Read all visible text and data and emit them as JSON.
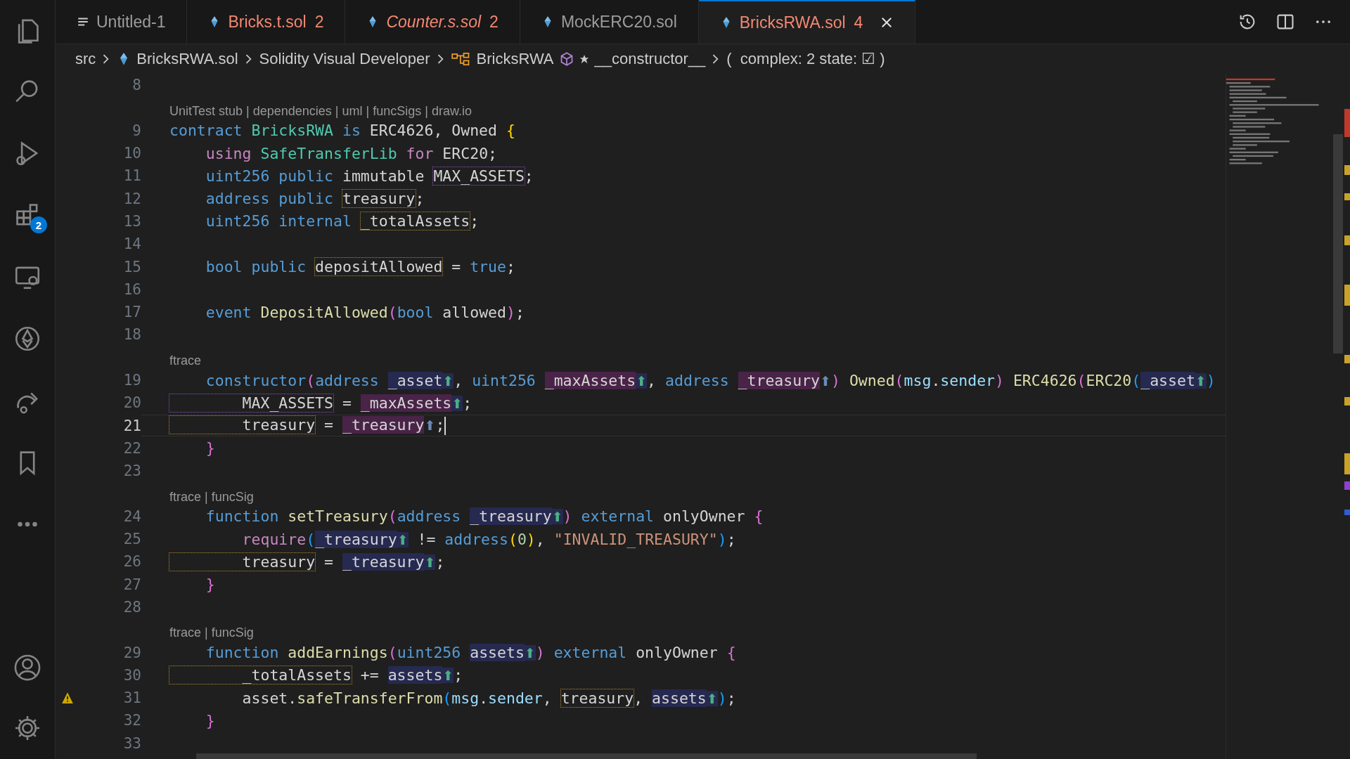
{
  "activity_bar": {
    "items": [
      {
        "kind": "files"
      },
      {
        "kind": "search"
      },
      {
        "kind": "debug"
      },
      {
        "kind": "extensions",
        "badge": "2"
      },
      {
        "kind": "remote"
      },
      {
        "kind": "ethereum"
      },
      {
        "kind": "share"
      },
      {
        "kind": "bookmark"
      },
      {
        "kind": "more"
      }
    ],
    "bottom": [
      {
        "kind": "account"
      },
      {
        "kind": "settings"
      }
    ]
  },
  "tabs": [
    {
      "label": "Untitled-1",
      "kind": "text",
      "error": false,
      "italic": false,
      "selected": false
    },
    {
      "label": "Bricks.t.sol",
      "kind": "solidity",
      "badge": "2",
      "error": true,
      "italic": false,
      "selected": false
    },
    {
      "label": "Counter.s.sol",
      "kind": "solidity",
      "badge": "2",
      "error": true,
      "italic": true,
      "selected": false
    },
    {
      "label": "MockERC20.sol",
      "kind": "solidity",
      "error": false,
      "italic": false,
      "selected": false
    },
    {
      "label": "BricksRWA.sol",
      "kind": "solidity",
      "badge": "4",
      "error": true,
      "italic": false,
      "selected": true
    }
  ],
  "breadcrumbs": [
    {
      "text": "src",
      "kind": "folder"
    },
    {
      "text": "BricksRWA.sol",
      "kind": "solidity"
    },
    {
      "text": "Solidity Visual Developer",
      "kind": "folder"
    },
    {
      "text": "BricksRWA",
      "kind": "class"
    },
    {
      "text": "__constructor__",
      "kind": "method"
    },
    {
      "text": "(  complex: 2 state: ☑ )",
      "kind": "folder"
    }
  ],
  "lines": [
    {
      "kind": "code",
      "number": "8",
      "current": false,
      "warning": false
    },
    {
      "kind": "lens",
      "text": "UnitTest stub | dependencies | uml | funcSigs | draw.io"
    },
    {
      "kind": "code",
      "number": "9",
      "current": false,
      "warning": false,
      "tokens": [
        {
          "text": "contract ",
          "kind": "kw"
        },
        {
          "text": "BricksRWA",
          "kind": "type"
        },
        {
          "text": " is ",
          "kind": "kw"
        },
        {
          "text": "ERC4626, Owned ",
          "kind": "plain"
        },
        {
          "text": "{",
          "kind": "b1"
        }
      ]
    },
    {
      "kind": "code",
      "number": "10",
      "current": false,
      "warning": false,
      "tokens": [
        {
          "text": "    using ",
          "kind": "ctrl"
        },
        {
          "text": "SafeTransferLib",
          "kind": "type"
        },
        {
          "text": " for ",
          "kind": "ctrl"
        },
        {
          "text": "ERC20;",
          "kind": "plain"
        }
      ]
    },
    {
      "kind": "code",
      "number": "11",
      "current": false,
      "warning": false,
      "tokens": [
        {
          "text": "    uint256 public",
          "kind": "kw"
        },
        {
          "text": " immutable ",
          "kind": "plain"
        },
        {
          "text": "MAX_ASSETS",
          "kind": "boxed2"
        },
        {
          "text": ";",
          "kind": "plain"
        }
      ]
    },
    {
      "kind": "code",
      "number": "12",
      "current": false,
      "warning": false,
      "tokens": [
        {
          "text": "    address public ",
          "kind": "kw"
        },
        {
          "text": "treasury",
          "kind": "boxed"
        },
        {
          "text": ";",
          "kind": "plain"
        }
      ]
    },
    {
      "kind": "code",
      "number": "13",
      "current": false,
      "warning": false,
      "tokens": [
        {
          "text": "    uint256 internal ",
          "kind": "kw"
        },
        {
          "text": "_totalAssets",
          "kind": "boxed"
        },
        {
          "text": ";",
          "kind": "plain"
        }
      ]
    },
    {
      "kind": "code",
      "number": "14",
      "current": false,
      "warning": false
    },
    {
      "kind": "code",
      "number": "15",
      "current": false,
      "warning": false,
      "tokens": [
        {
          "text": "    bool public ",
          "kind": "kw"
        },
        {
          "text": "depositAllowed",
          "kind": "boxed"
        },
        {
          "text": " = ",
          "kind": "plain"
        },
        {
          "text": "true",
          "kind": "kw"
        },
        {
          "text": ";",
          "kind": "plain"
        }
      ]
    },
    {
      "kind": "code",
      "number": "16",
      "current": false,
      "warning": false
    },
    {
      "kind": "code",
      "number": "17",
      "current": false,
      "warning": false,
      "tokens": [
        {
          "text": "    event ",
          "kind": "kw"
        },
        {
          "text": "DepositAllowed",
          "kind": "fn"
        },
        {
          "text": "(",
          "kind": "b2"
        },
        {
          "text": "bool",
          "kind": "kw"
        },
        {
          "text": " allowed",
          "kind": "plain"
        },
        {
          "text": ")",
          "kind": "b2"
        },
        {
          "text": ";",
          "kind": "plain"
        }
      ]
    },
    {
      "kind": "code",
      "number": "18",
      "current": false,
      "warning": false
    },
    {
      "kind": "lens",
      "text": "ftrace"
    },
    {
      "kind": "code",
      "number": "19",
      "current": false,
      "warning": false,
      "tokens": [
        {
          "text": "    constructor",
          "kind": "kw"
        },
        {
          "text": "(",
          "kind": "b2"
        },
        {
          "text": "address ",
          "kind": "kw"
        },
        {
          "text": "_asset",
          "kind": "param"
        },
        {
          "text": "⬆",
          "kind": "arrow"
        },
        {
          "text": ", ",
          "kind": "plain"
        },
        {
          "text": "uint256 ",
          "kind": "kw"
        },
        {
          "text": "_maxAssets",
          "kind": "param2"
        },
        {
          "text": "⬆",
          "kind": "arrow"
        },
        {
          "text": ", ",
          "kind": "plain"
        },
        {
          "text": "address ",
          "kind": "kw"
        },
        {
          "text": "_treasury",
          "kind": "param2"
        },
        {
          "text": "⬆",
          "kind": "arrow2"
        },
        {
          "text": ")",
          "kind": "b2"
        },
        {
          "text": " Owned",
          "kind": "fn"
        },
        {
          "text": "(",
          "kind": "b2"
        },
        {
          "text": "msg",
          "kind": "var"
        },
        {
          "text": ".",
          "kind": "plain"
        },
        {
          "text": "sender",
          "kind": "var"
        },
        {
          "text": ")",
          "kind": "b2"
        },
        {
          "text": " ERC4626",
          "kind": "fn"
        },
        {
          "text": "(",
          "kind": "b2"
        },
        {
          "text": "ERC20",
          "kind": "fn"
        },
        {
          "text": "(",
          "kind": "b3"
        },
        {
          "text": "_asset",
          "kind": "param"
        },
        {
          "text": "⬆",
          "kind": "arrow"
        },
        {
          "text": ")",
          "kind": "b3"
        }
      ]
    },
    {
      "kind": "code",
      "number": "20",
      "current": false,
      "warning": false,
      "tokens": [
        {
          "text": "        MAX_ASSETS",
          "kind": "boxed2"
        },
        {
          "text": " = ",
          "kind": "plain"
        },
        {
          "text": "_maxAssets",
          "kind": "param2"
        },
        {
          "text": "⬆",
          "kind": "arrow"
        },
        {
          "text": ";",
          "kind": "plain"
        }
      ]
    },
    {
      "kind": "code",
      "number": "21",
      "current": true,
      "warning": false,
      "tokens": [
        {
          "text": "        treasury",
          "kind": "boxed"
        },
        {
          "text": " = ",
          "kind": "plain"
        },
        {
          "text": "_treasury",
          "kind": "param2"
        },
        {
          "text": "⬆",
          "kind": "arrow2"
        },
        {
          "text": ";",
          "kind": "plain"
        }
      ]
    },
    {
      "kind": "code",
      "number": "22",
      "current": false,
      "warning": false,
      "tokens": [
        {
          "text": "    }",
          "kind": "b2"
        }
      ]
    },
    {
      "kind": "code",
      "number": "23",
      "current": false,
      "warning": false
    },
    {
      "kind": "lens",
      "text": "ftrace | funcSig"
    },
    {
      "kind": "code",
      "number": "24",
      "current": false,
      "warning": false,
      "tokens": [
        {
          "text": "    function ",
          "kind": "kw"
        },
        {
          "text": "setTreasury",
          "kind": "fn"
        },
        {
          "text": "(",
          "kind": "b2"
        },
        {
          "text": "address ",
          "kind": "kw"
        },
        {
          "text": "_treasury",
          "kind": "param"
        },
        {
          "text": "⬆",
          "kind": "arrow"
        },
        {
          "text": ")",
          "kind": "b2"
        },
        {
          "text": " external",
          "kind": "kw"
        },
        {
          "text": " onlyOwner ",
          "kind": "plain"
        },
        {
          "text": "{",
          "kind": "b2"
        }
      ]
    },
    {
      "kind": "code",
      "number": "25",
      "current": false,
      "warning": false,
      "tokens": [
        {
          "text": "        require",
          "kind": "ctrl"
        },
        {
          "text": "(",
          "kind": "b3"
        },
        {
          "text": "_treasury",
          "kind": "param"
        },
        {
          "text": "⬆",
          "kind": "arrow"
        },
        {
          "text": " != ",
          "kind": "plain"
        },
        {
          "text": "address",
          "kind": "kw"
        },
        {
          "text": "(",
          "kind": "b1"
        },
        {
          "text": "0",
          "kind": "num"
        },
        {
          "text": ")",
          "kind": "b1"
        },
        {
          "text": ", ",
          "kind": "plain"
        },
        {
          "text": "\"INVALID_TREASURY\"",
          "kind": "str"
        },
        {
          "text": ")",
          "kind": "b3"
        },
        {
          "text": ";",
          "kind": "plain"
        }
      ]
    },
    {
      "kind": "code",
      "number": "26",
      "current": false,
      "warning": false,
      "tokens": [
        {
          "text": "        treasury",
          "kind": "boxed"
        },
        {
          "text": " = ",
          "kind": "plain"
        },
        {
          "text": "_treasury",
          "kind": "param"
        },
        {
          "text": "⬆",
          "kind": "arrow"
        },
        {
          "text": ";",
          "kind": "plain"
        }
      ]
    },
    {
      "kind": "code",
      "number": "27",
      "current": false,
      "warning": false,
      "tokens": [
        {
          "text": "    }",
          "kind": "b2"
        }
      ]
    },
    {
      "kind": "code",
      "number": "28",
      "current": false,
      "warning": false
    },
    {
      "kind": "lens",
      "text": "ftrace | funcSig"
    },
    {
      "kind": "code",
      "number": "29",
      "current": false,
      "warning": false,
      "tokens": [
        {
          "text": "    function ",
          "kind": "kw"
        },
        {
          "text": "addEarnings",
          "kind": "fn"
        },
        {
          "text": "(",
          "kind": "b2"
        },
        {
          "text": "uint256 ",
          "kind": "kw"
        },
        {
          "text": "assets",
          "kind": "param"
        },
        {
          "text": "⬆",
          "kind": "arrow"
        },
        {
          "text": ")",
          "kind": "b2"
        },
        {
          "text": " external",
          "kind": "kw"
        },
        {
          "text": " onlyOwner ",
          "kind": "plain"
        },
        {
          "text": "{",
          "kind": "b2"
        }
      ]
    },
    {
      "kind": "code",
      "number": "30",
      "current": false,
      "warning": false,
      "tokens": [
        {
          "text": "        _totalAssets",
          "kind": "boxed"
        },
        {
          "text": " += ",
          "kind": "plain"
        },
        {
          "text": "assets",
          "kind": "param"
        },
        {
          "text": "⬆",
          "kind": "arrow"
        },
        {
          "text": ";",
          "kind": "plain"
        }
      ]
    },
    {
      "kind": "code",
      "number": "31",
      "current": false,
      "warning": true,
      "tokens": [
        {
          "text": "        asset.",
          "kind": "plain"
        },
        {
          "text": "safeTransferFrom",
          "kind": "fn"
        },
        {
          "text": "(",
          "kind": "b3"
        },
        {
          "text": "msg",
          "kind": "var"
        },
        {
          "text": ".",
          "kind": "plain"
        },
        {
          "text": "sender",
          "kind": "var"
        },
        {
          "text": ", ",
          "kind": "plain"
        },
        {
          "text": "treasury",
          "kind": "boxed"
        },
        {
          "text": ", ",
          "kind": "plain"
        },
        {
          "text": "assets",
          "kind": "param"
        },
        {
          "text": "⬆",
          "kind": "arrow"
        },
        {
          "text": ")",
          "kind": "b3"
        },
        {
          "text": ";",
          "kind": "plain"
        }
      ]
    },
    {
      "kind": "code",
      "number": "32",
      "current": false,
      "warning": false,
      "tokens": [
        {
          "text": "    }",
          "kind": "b2"
        }
      ]
    },
    {
      "kind": "code",
      "number": "33",
      "current": false,
      "warning": false
    }
  ]
}
